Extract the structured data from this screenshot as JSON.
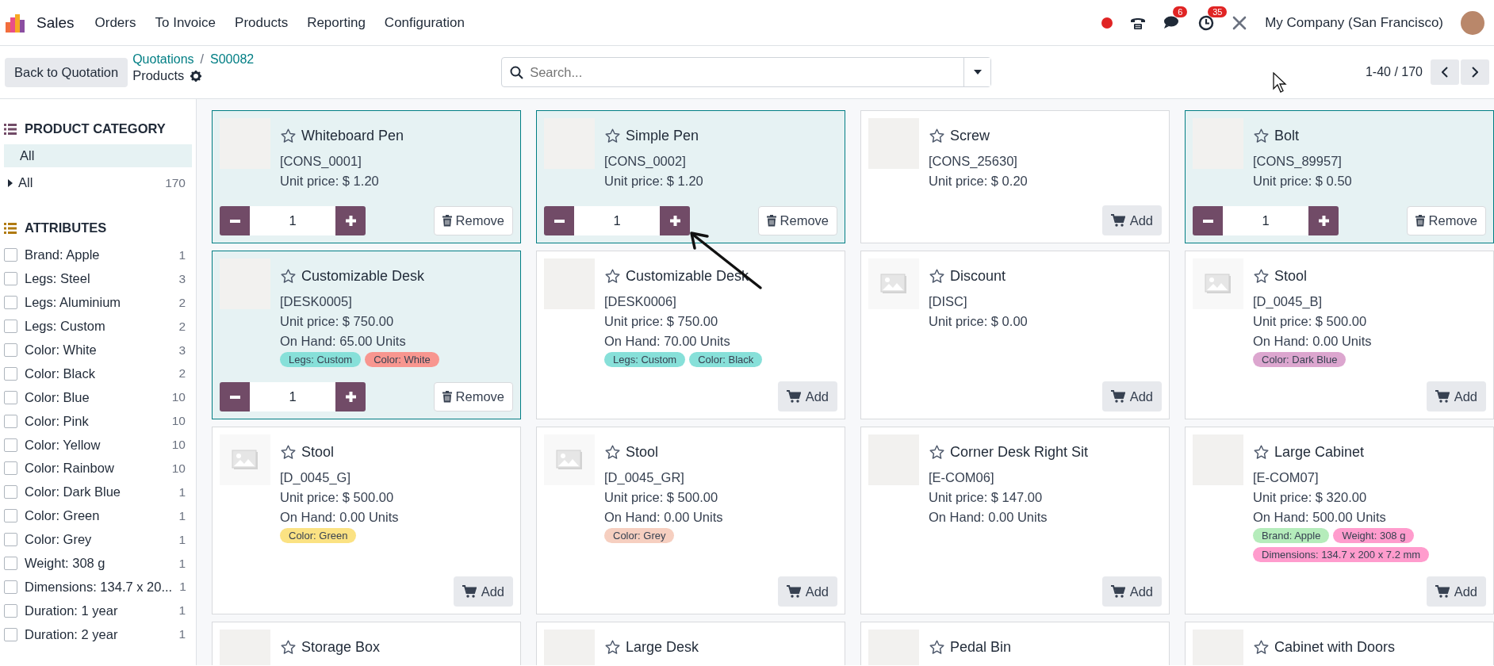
{
  "navbar": {
    "app_name": "Sales",
    "menu": [
      "Orders",
      "To Invoice",
      "Products",
      "Reporting",
      "Configuration"
    ],
    "messages_badge": "6",
    "activities_badge": "35",
    "company": "My Company (San Francisco)"
  },
  "control_panel": {
    "back_button": "Back to Quotation",
    "breadcrumbs": [
      "Quotations",
      "S00082"
    ],
    "breadcrumb_separator": "/",
    "title": "Products",
    "search": {
      "placeholder": "Search..."
    },
    "pager": "1-40 / 170"
  },
  "sidebar": {
    "category_heading": "PRODUCT CATEGORY",
    "categories": [
      {
        "label": "All",
        "selected": true
      }
    ],
    "category_tree": [
      {
        "label": "All",
        "count": "170",
        "expanded": false
      }
    ],
    "attributes_heading": "ATTRIBUTES",
    "attributes": [
      {
        "label": "Brand: Apple",
        "count": "1",
        "checked": false
      },
      {
        "label": "Legs: Steel",
        "count": "3",
        "checked": false
      },
      {
        "label": "Legs: Aluminium",
        "count": "2",
        "checked": false
      },
      {
        "label": "Legs: Custom",
        "count": "2",
        "checked": false
      },
      {
        "label": "Color: White",
        "count": "3",
        "checked": false
      },
      {
        "label": "Color: Black",
        "count": "2",
        "checked": false
      },
      {
        "label": "Color: Blue",
        "count": "10",
        "checked": false
      },
      {
        "label": "Color: Pink",
        "count": "10",
        "checked": false
      },
      {
        "label": "Color: Yellow",
        "count": "10",
        "checked": false
      },
      {
        "label": "Color: Rainbow",
        "count": "10",
        "checked": false
      },
      {
        "label": "Color: Dark Blue",
        "count": "1",
        "checked": false
      },
      {
        "label": "Color: Green",
        "count": "1",
        "checked": false
      },
      {
        "label": "Color: Grey",
        "count": "1",
        "checked": false
      },
      {
        "label": "Weight: 308 g",
        "count": "1",
        "checked": false
      },
      {
        "label": "Dimensions: 134.7 x 20...",
        "count": "1",
        "checked": false
      },
      {
        "label": "Duration: 1 year",
        "count": "1",
        "checked": false
      },
      {
        "label": "Duration: 2 year",
        "count": "1",
        "checked": false
      }
    ]
  },
  "products": [
    {
      "name": "Whiteboard Pen",
      "kind": "photo",
      "favorite": false,
      "code": "[CONS_0001]",
      "price": "Unit price: $ 1.20",
      "in_order": true,
      "quantity": "1",
      "button": "Remove"
    },
    {
      "name": "Simple Pen",
      "kind": "photo",
      "favorite": false,
      "code": "[CONS_0002]",
      "price": "Unit price: $ 1.20",
      "in_order": true,
      "quantity": "1",
      "button": "Remove"
    },
    {
      "name": "Screw",
      "kind": "photo",
      "favorite": false,
      "code": "[CONS_25630]",
      "price": "Unit price: $ 0.20",
      "in_order": false,
      "button": "Add"
    },
    {
      "name": "Bolt",
      "kind": "photo",
      "favorite": false,
      "code": "[CONS_89957]",
      "price": "Unit price: $ 0.50",
      "in_order": true,
      "quantity": "1",
      "button": "Remove"
    },
    {
      "name": "Customizable Desk",
      "kind": "photo",
      "favorite": false,
      "code": "[DESK0005]",
      "price": "Unit price: $ 750.00",
      "on_hand": "On Hand: 65.00 Units",
      "tags": [
        {
          "label": "Legs: Custom",
          "color": "#87e0d9"
        },
        {
          "label": "Color: White",
          "color": "#f8968f"
        }
      ],
      "in_order": true,
      "quantity": "1",
      "button": "Remove"
    },
    {
      "name": "Customizable Desk",
      "kind": "photo",
      "favorite": false,
      "code": "[DESK0006]",
      "price": "Unit price: $ 750.00",
      "on_hand": "On Hand: 70.00 Units",
      "tags": [
        {
          "label": "Legs: Custom",
          "color": "#87e0d9"
        },
        {
          "label": "Color: Black",
          "color": "#87e0d9"
        }
      ],
      "in_order": false,
      "button": "Add"
    },
    {
      "name": "Discount",
      "kind": "placeholder",
      "favorite": false,
      "code": "[DISC]",
      "price": "Unit price: $ 0.00",
      "in_order": false,
      "button": "Add"
    },
    {
      "name": "Stool",
      "kind": "placeholder",
      "favorite": false,
      "code": "[D_0045_B]",
      "price": "Unit price: $ 500.00",
      "on_hand": "On Hand: 0.00 Units",
      "tags": [
        {
          "label": "Color: Dark Blue",
          "color": "#dca6cf"
        }
      ],
      "in_order": false,
      "button": "Add"
    },
    {
      "name": "Stool",
      "kind": "placeholder",
      "favorite": false,
      "code": "[D_0045_G]",
      "price": "Unit price: $ 500.00",
      "on_hand": "On Hand: 0.00 Units",
      "tags": [
        {
          "label": "Color: Green",
          "color": "#fbe283"
        }
      ],
      "in_order": false,
      "button": "Add"
    },
    {
      "name": "Stool",
      "kind": "placeholder",
      "favorite": false,
      "code": "[D_0045_GR]",
      "price": "Unit price: $ 500.00",
      "on_hand": "On Hand: 0.00 Units",
      "tags": [
        {
          "label": "Color: Grey",
          "color": "#f6cfc0"
        }
      ],
      "in_order": false,
      "button": "Add"
    },
    {
      "name": "Corner Desk Right Sit",
      "kind": "photo",
      "favorite": false,
      "code": "[E-COM06]",
      "price": "Unit price: $ 147.00",
      "on_hand": "On Hand: 0.00 Units",
      "in_order": false,
      "button": "Add"
    },
    {
      "name": "Large Cabinet",
      "kind": "photo",
      "favorite": false,
      "code": "[E-COM07]",
      "price": "Unit price: $ 320.00",
      "on_hand": "On Hand: 500.00 Units",
      "tags": [
        {
          "label": "Brand: Apple",
          "color": "#b5ecbb"
        },
        {
          "label": "Weight: 308 g",
          "color": "#ff9ccd"
        },
        {
          "label": "Dimensions: 134.7 x 200 x 7.2 mm",
          "color": "#ff9ccd"
        }
      ],
      "in_order": false,
      "button": "Add"
    },
    {
      "name": "Storage Box",
      "kind": "photo",
      "favorite": false,
      "in_order": false
    },
    {
      "name": "Large Desk",
      "kind": "photo",
      "favorite": false,
      "in_order": false
    },
    {
      "name": "Pedal Bin",
      "kind": "photo",
      "favorite": false,
      "in_order": false
    },
    {
      "name": "Cabinet with Doors",
      "kind": "photo",
      "favorite": false,
      "in_order": false
    }
  ]
}
